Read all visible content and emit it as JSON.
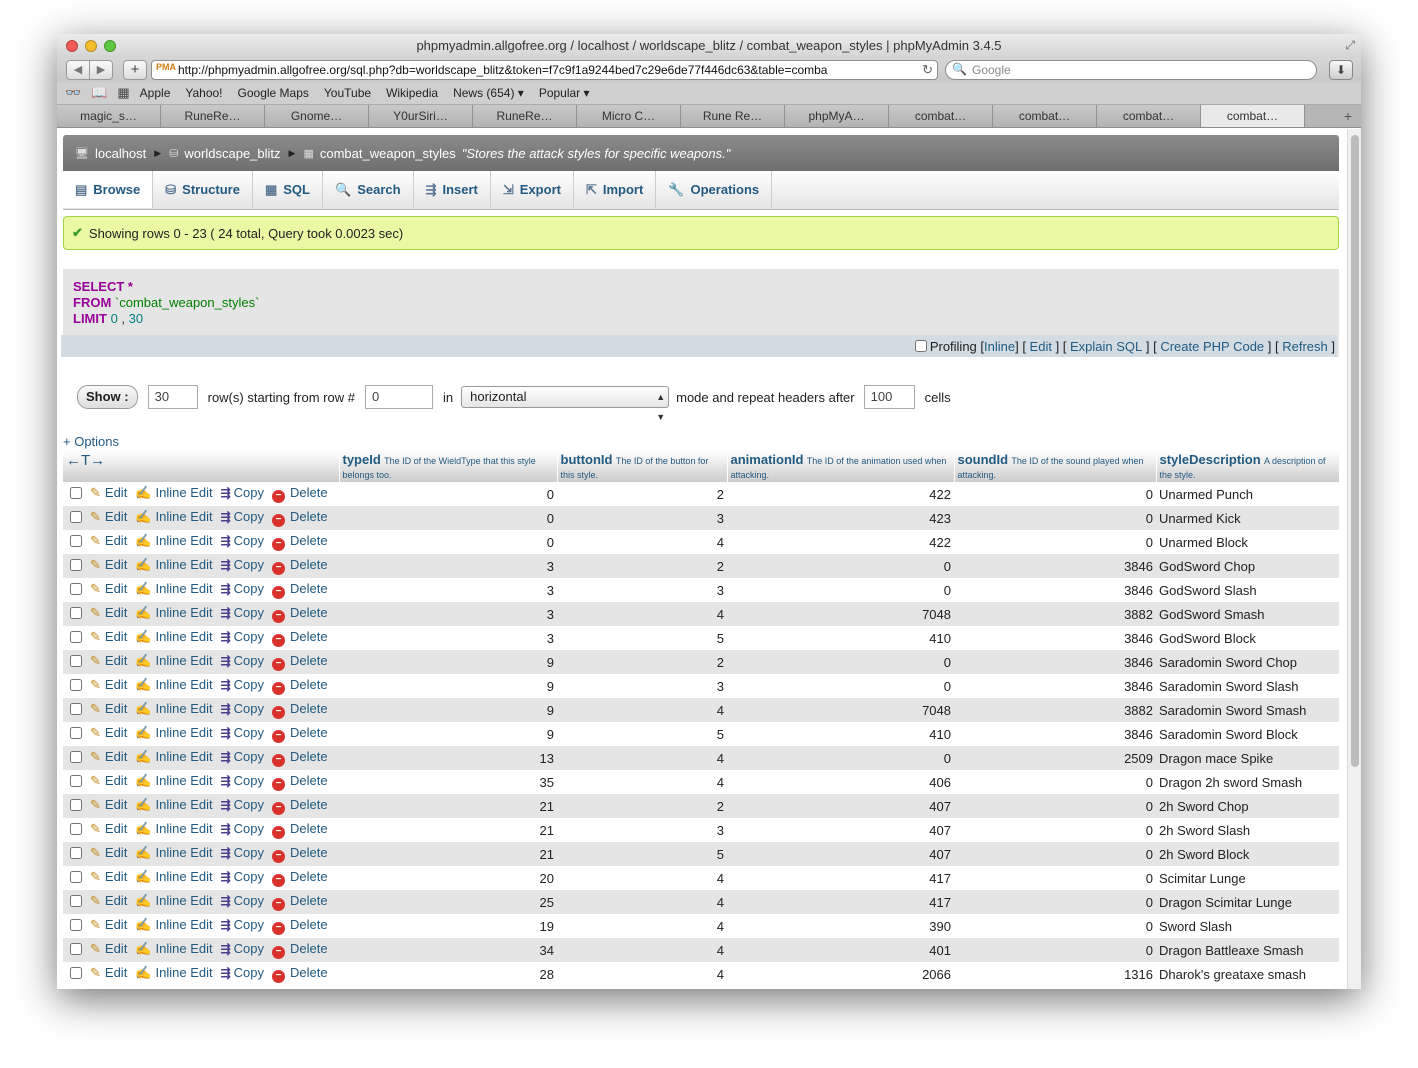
{
  "window": {
    "title": "phpmyadmin.allgofree.org / localhost / worldscape_blitz / combat_weapon_styles | phpMyAdmin 3.4.5"
  },
  "browser": {
    "url": "http://phpmyadmin.allgofree.org/sql.php?db=worldscape_blitz&token=f7c9f1a9244bed7c29e6de77f446dc63&table=comba",
    "search_placeholder": "Google",
    "bookmarks": [
      "Apple",
      "Yahoo!",
      "Google Maps",
      "YouTube",
      "Wikipedia",
      "News (654) ▾",
      "Popular ▾"
    ],
    "tabs": [
      "magic_s…",
      "RuneRe…",
      "Gnome…",
      "Y0urSiri…",
      "RuneRe…",
      "Micro C…",
      "Rune Re…",
      "phpMyA…",
      "combat…",
      "combat…",
      "combat…",
      "combat…"
    ],
    "active_tab_index": 11
  },
  "breadcrumb": {
    "server": "localhost",
    "database": "worldscape_blitz",
    "table": "combat_weapon_styles",
    "comment": "\"Stores the attack styles for specific weapons.\""
  },
  "menu": {
    "tabs": [
      {
        "label": "Browse",
        "icon": "▤"
      },
      {
        "label": "Structure",
        "icon": "⛁"
      },
      {
        "label": "SQL",
        "icon": "▦"
      },
      {
        "label": "Search",
        "icon": "🔍"
      },
      {
        "label": "Insert",
        "icon": "⇶"
      },
      {
        "label": "Export",
        "icon": "⇲"
      },
      {
        "label": "Import",
        "icon": "⇱"
      },
      {
        "label": "Operations",
        "icon": "🔧"
      }
    ]
  },
  "notice": {
    "text": "Showing rows 0 - 23 ( 24 total, Query took 0.0023 sec)"
  },
  "sql": {
    "select": "SELECT",
    "star": "*",
    "from": "FROM",
    "table": "`combat_weapon_styles`",
    "limit": "LIMIT",
    "offset": "0",
    "comma": ",",
    "count": "30",
    "profiling": "Profiling",
    "links": [
      "Inline",
      "Edit",
      "Explain SQL",
      "Create PHP Code",
      "Refresh"
    ]
  },
  "nav": {
    "show_label": "Show :",
    "rows_value": "30",
    "rows_text": "row(s) starting from row #",
    "start_value": "0",
    "in_text": "in",
    "mode_value": "horizontal",
    "mode_text": "mode and repeat headers after",
    "repeat_value": "100",
    "cells_text": "cells"
  },
  "options_label": "+ Options",
  "table": {
    "arrows": "←T→",
    "columns": [
      {
        "name": "typeId",
        "comment": "The ID of the WieldType that this style belongs too."
      },
      {
        "name": "buttonId",
        "comment": "The ID of the button for this style."
      },
      {
        "name": "animationId",
        "comment": "The ID of the animation used when attacking."
      },
      {
        "name": "soundId",
        "comment": "The ID of the sound played when attacking."
      },
      {
        "name": "styleDescription",
        "comment": "A description of the style."
      }
    ],
    "actions": {
      "edit": "Edit",
      "inline_edit": "Inline Edit",
      "copy": "Copy",
      "delete": "Delete"
    },
    "rows": [
      [
        "0",
        "2",
        "422",
        "0",
        "Unarmed Punch"
      ],
      [
        "0",
        "3",
        "423",
        "0",
        "Unarmed Kick"
      ],
      [
        "0",
        "4",
        "422",
        "0",
        "Unarmed Block"
      ],
      [
        "3",
        "2",
        "0",
        "3846",
        "GodSword Chop"
      ],
      [
        "3",
        "3",
        "0",
        "3846",
        "GodSword Slash"
      ],
      [
        "3",
        "4",
        "7048",
        "3882",
        "GodSword Smash"
      ],
      [
        "3",
        "5",
        "410",
        "3846",
        "GodSword Block"
      ],
      [
        "9",
        "2",
        "0",
        "3846",
        "Saradomin Sword Chop"
      ],
      [
        "9",
        "3",
        "0",
        "3846",
        "Saradomin Sword Slash"
      ],
      [
        "9",
        "4",
        "7048",
        "3882",
        "Saradomin Sword Smash"
      ],
      [
        "9",
        "5",
        "410",
        "3846",
        "Saradomin Sword Block"
      ],
      [
        "13",
        "4",
        "0",
        "2509",
        "Dragon mace Spike"
      ],
      [
        "35",
        "4",
        "406",
        "0",
        "Dragon 2h sword Smash"
      ],
      [
        "21",
        "2",
        "407",
        "0",
        "2h Sword Chop"
      ],
      [
        "21",
        "3",
        "407",
        "0",
        "2h Sword Slash"
      ],
      [
        "21",
        "5",
        "407",
        "0",
        "2h Sword Block"
      ],
      [
        "20",
        "4",
        "417",
        "0",
        "Scimitar Lunge"
      ],
      [
        "25",
        "4",
        "417",
        "0",
        "Dragon Scimitar Lunge"
      ],
      [
        "19",
        "4",
        "390",
        "0",
        "Sword Slash"
      ],
      [
        "34",
        "4",
        "401",
        "0",
        "Dragon Battleaxe Smash"
      ],
      [
        "28",
        "4",
        "2066",
        "1316",
        "Dharok's greataxe smash"
      ]
    ]
  }
}
